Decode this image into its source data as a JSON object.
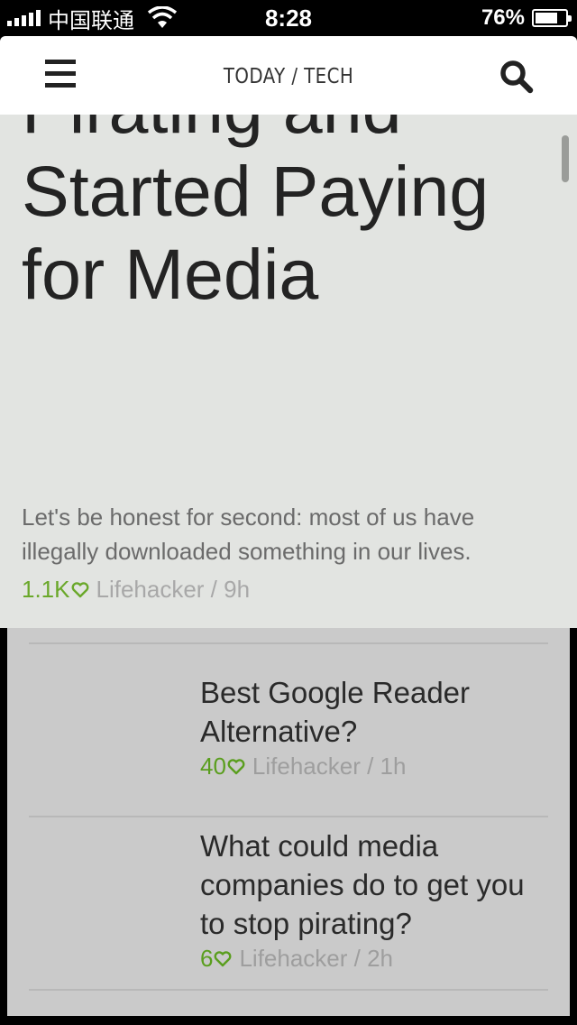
{
  "status_bar": {
    "carrier": "中国联通",
    "time": "8:28",
    "battery": "76%",
    "battery_level": 0.76
  },
  "header": {
    "title": "TODAY / TECH",
    "menu_icon": "hamburger-menu-icon",
    "search_icon": "search-icon"
  },
  "featured": {
    "title_partial_line": "Pirating and",
    "title_line_2": "Started Paying",
    "title_line_3": "for Media",
    "summary": "Let's be honest for second: most of us have illegally downloaded something in our lives.",
    "likes": "1.1K",
    "source_time": "Lifehacker / 9h"
  },
  "articles": [
    {
      "title_lines": [
        "Best Google Reader",
        "Alternative?"
      ],
      "likes": "40",
      "source_time": "Lifehacker / 1h"
    },
    {
      "title_lines": [
        "What could media",
        "companies do to get you",
        "to stop pirating?"
      ],
      "likes": "6",
      "source_time": "Lifehacker / 2h"
    }
  ],
  "colors": {
    "accent_green": "#5a9e1e",
    "featured_bg": "#e2e4e1",
    "list_bg": "#cacaca"
  }
}
